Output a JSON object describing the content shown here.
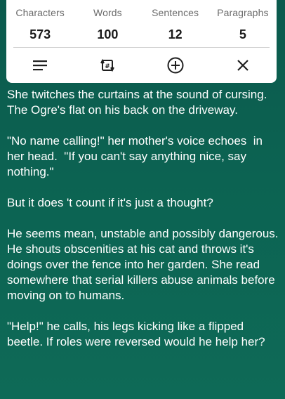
{
  "stats": [
    {
      "label": "Characters",
      "value": "573"
    },
    {
      "label": "Words",
      "value": "100"
    },
    {
      "label": "Sentences",
      "value": "12"
    },
    {
      "label": "Paragraphs",
      "value": "5"
    }
  ],
  "toolbar": {
    "icons": [
      "menu-lines-icon",
      "swap-tag-icon",
      "add-circle-icon",
      "close-icon"
    ]
  },
  "text": {
    "paragraphs": [
      "She twitches the curtains at the sound of cursing. The Ogre's flat on his back on the driveway.",
      "\"No name calling!\" her mother's voice echoes  in her head.  \"If you can't say anything nice, say nothing.\"",
      "But it does 't count if it's just a thought?",
      "He seems mean, unstable and possibly dangerous. He shouts obscenities at his cat and throws it's doings over the fence into her garden. She read somewhere that serial killers abuse animals before moving on to humans.",
      "\"Help!\" he calls, his legs kicking like a flipped beetle. If roles were reversed would he help her?"
    ]
  },
  "colors": {
    "background": "#0c6352",
    "card": "#ffffff",
    "icon": "#1f1f1f"
  }
}
